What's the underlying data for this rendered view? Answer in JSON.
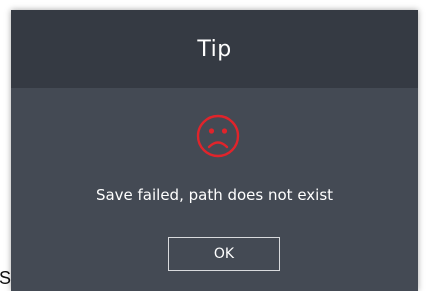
{
  "page": {
    "fragment_text": "S"
  },
  "dialog": {
    "title": "Tip",
    "icon": "sad-face-icon",
    "icon_color": "#e0242b",
    "message": "Save failed, path does not exist",
    "ok_label": "OK"
  },
  "colors": {
    "header_bg": "#353a43",
    "body_bg": "#444a54",
    "text": "#ffffff"
  }
}
